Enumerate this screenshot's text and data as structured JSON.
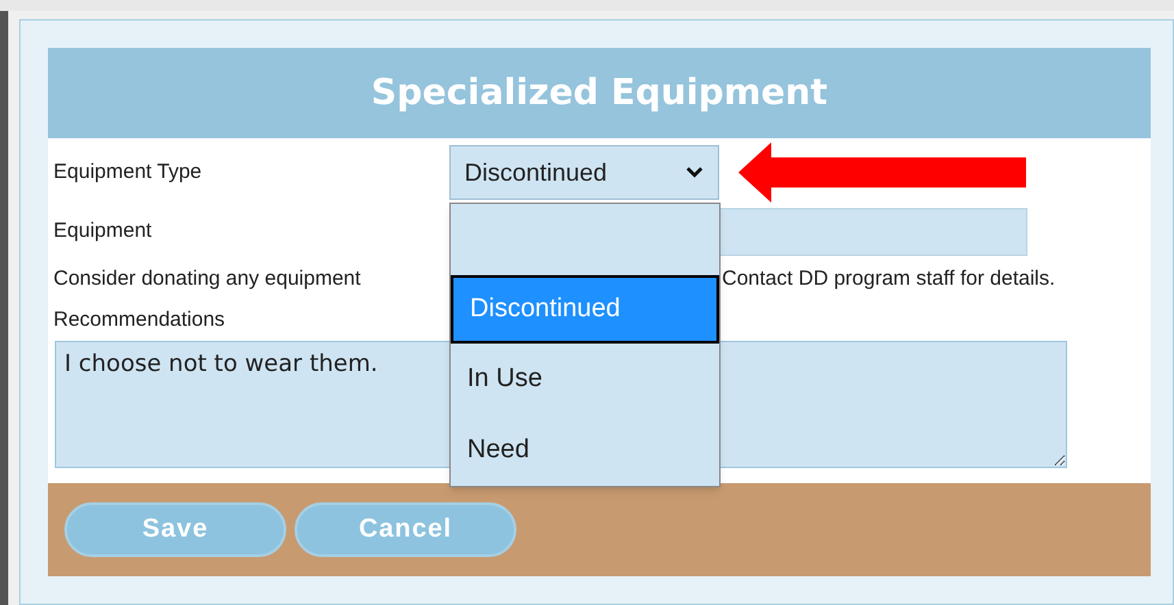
{
  "dialog": {
    "title": "Specialized Equipment"
  },
  "form": {
    "equipment_type": {
      "label": "Equipment Type",
      "value": "Discontinued",
      "expanded": true,
      "options": [
        {
          "label": "Discontinued",
          "selected": true
        },
        {
          "label": "In Use",
          "selected": false
        },
        {
          "label": "Need",
          "selected": false
        }
      ]
    },
    "equipment": {
      "label": "Equipment"
    },
    "note_start": "Consider donating any equipment",
    "note_end": "Contact DD program staff for details.",
    "recommendations": {
      "label": "Recommendations",
      "value": "I choose not to wear them."
    }
  },
  "buttons": [
    "Save",
    "Cancel"
  ]
}
